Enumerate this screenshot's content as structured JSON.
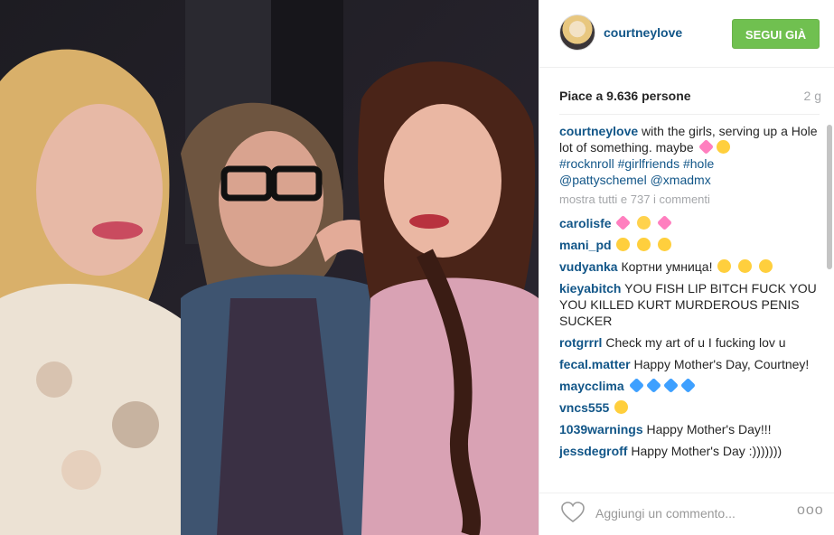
{
  "header": {
    "username": "courtneylove",
    "follow_label": "SEGUI GIÀ"
  },
  "stats": {
    "likes": "Piace a 9.636 persone",
    "age": "2 g"
  },
  "caption": {
    "user": "courtneylove",
    "text": " with the girls, serving up a Hole lot of something. maybe ",
    "hashtags": [
      "#rocknroll",
      "#girlfriends",
      "#hole"
    ],
    "mentions": [
      "@pattyschemel",
      "@xmadmx"
    ]
  },
  "show_all": "mostra tutti e 737 i commenti",
  "comments": [
    {
      "user": "carolisfe",
      "text": ""
    },
    {
      "user": "mani_pd",
      "text": ""
    },
    {
      "user": "vudyanka",
      "text": " Кортни умница!"
    },
    {
      "user": "kieyabitch",
      "text": " YOU FISH LIP BITCH FUCK YOU YOU KILLED KURT MURDEROUS PENIS SUCKER"
    },
    {
      "user": "rotgrrrl",
      "text": " Check my art of u I fucking lov u"
    },
    {
      "user": "fecal.matter",
      "text": " Happy Mother's Day, Courtney!"
    },
    {
      "user": "maycclima",
      "text": ""
    },
    {
      "user": "vncs555",
      "text": ""
    },
    {
      "user": "1039warnings",
      "text": " Happy Mother's Day!!!"
    },
    {
      "user": "jessdegroff",
      "text": " Happy Mother's Day :)))))))"
    }
  ],
  "footer": {
    "add_comment_placeholder": "Aggiungi un commento...",
    "more_label": "ooo"
  },
  "colors": {
    "follow_green": "#70c050",
    "username_blue": "#125688"
  }
}
